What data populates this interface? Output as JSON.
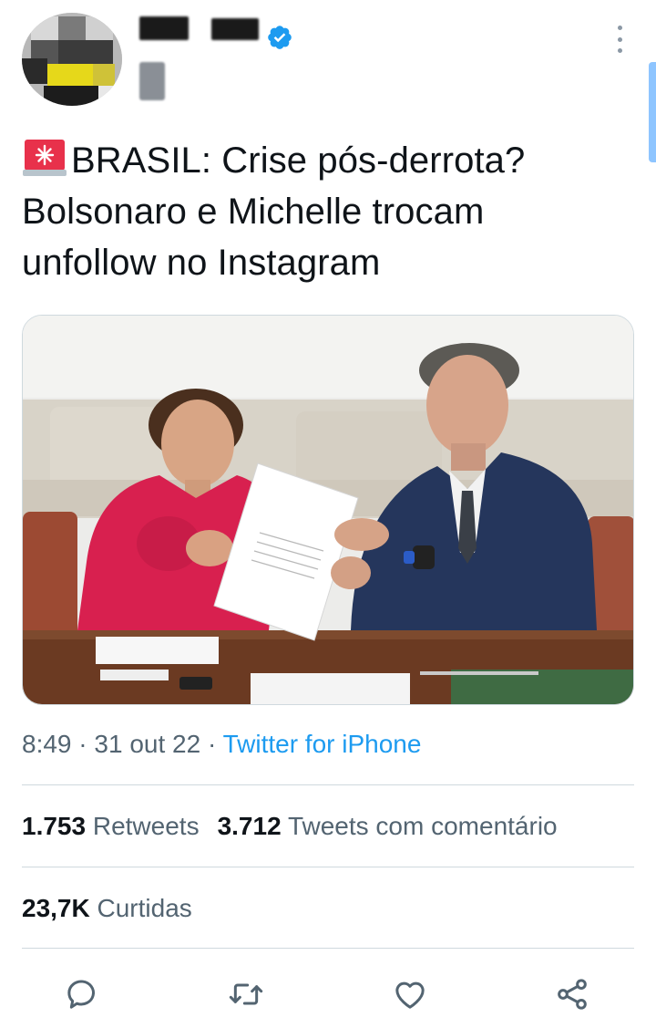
{
  "tweet": {
    "text_line1": "BRASIL: Crise pós-derrota?",
    "text_line2": "Bolsonaro e Michelle trocam",
    "text_line3": "unfollow no Instagram",
    "lead_emoji": "police-light-icon",
    "image_alt": "photo"
  },
  "meta": {
    "time": "8:49",
    "sep1": "·",
    "date": "31 out 22",
    "sep2": "·",
    "source": "Twitter for iPhone"
  },
  "stats": {
    "retweets_count": "1.753",
    "retweets_label": "Retweets",
    "quotes_count": "3.712",
    "quotes_label": "Tweets com comentário",
    "likes_count": "23,7K",
    "likes_label": "Curtidas"
  },
  "actions": [
    "reply-icon",
    "retweet-icon",
    "like-icon",
    "share-icon"
  ],
  "colors": {
    "accent": "#1d9bf0",
    "text": "#0f1419",
    "secondary": "#536471",
    "divider": "#cfd9de"
  }
}
